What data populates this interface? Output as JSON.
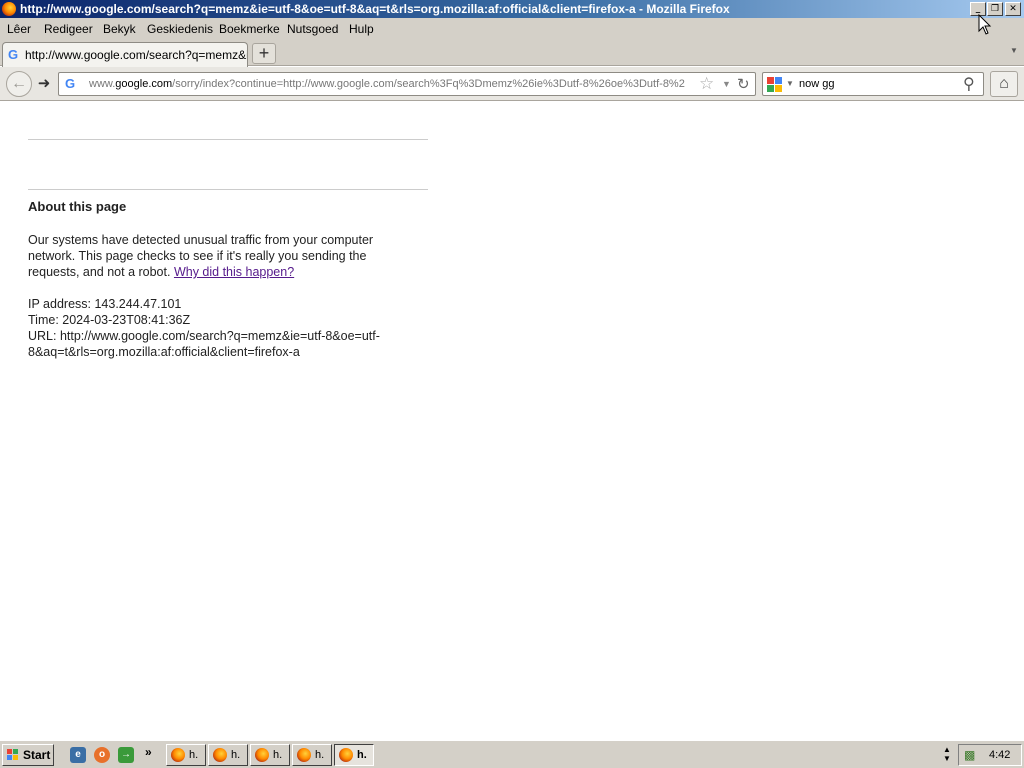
{
  "window": {
    "title": "http://www.google.com/search?q=memz&ie=utf-8&oe=utf-8&aq=t&rls=org.mozilla:af:official&client=firefox-a - Mozilla Firefox",
    "minimize_glyph": "_",
    "restore_glyph": "❐",
    "close_glyph": "✕"
  },
  "menu": {
    "items": [
      "Lêer",
      "Redigeer",
      "Bekyk",
      "Geskiedenis",
      "Boekmerke",
      "Nutsgoed",
      "Hulp"
    ]
  },
  "tabs": {
    "active_title": "http://www.google.com/search?q=memz&ie...",
    "new_tab_glyph": "+"
  },
  "navbar": {
    "url_prefix": "www.",
    "url_domain": "google.com",
    "url_rest": "/sorry/index?continue=http://www.google.com/search%3Fq%3Dmemz%26ie%3Dutf-8%26oe%3Dutf-8%2",
    "search_value": "now gg",
    "favicon_letter": "G"
  },
  "page": {
    "heading": "About this page",
    "paragraph": "Our systems have detected unusual traffic from your computer network. This page checks to see if it's really you sending the requests, and not a robot.",
    "link_text": "Why did this happen?",
    "ip_line": "IP address: 143.244.47.101",
    "time_line": "Time: 2024-03-23T08:41:36Z",
    "url_line_1": "URL: http://www.google.com/search?q=memz&ie=utf-8&oe=utf-",
    "url_line_2": "8&aq=t&rls=org.mozilla:af:official&client=firefox-a"
  },
  "taskbar": {
    "start_label": "Start",
    "task_label": "h.",
    "clock": "4:42",
    "quick_launch_chevron": "»"
  },
  "icons": {
    "back": "back-arrow-icon",
    "forward": "forward-arrow-icon",
    "star": "bookmark-star-icon",
    "reload": "reload-icon",
    "search": "magnifier-icon",
    "home": "home-icon"
  },
  "colors": {
    "titlebar_start": "#0a246a",
    "titlebar_end": "#a6caf0",
    "chrome": "#d4d0c8",
    "visited_link": "#551a8b"
  }
}
